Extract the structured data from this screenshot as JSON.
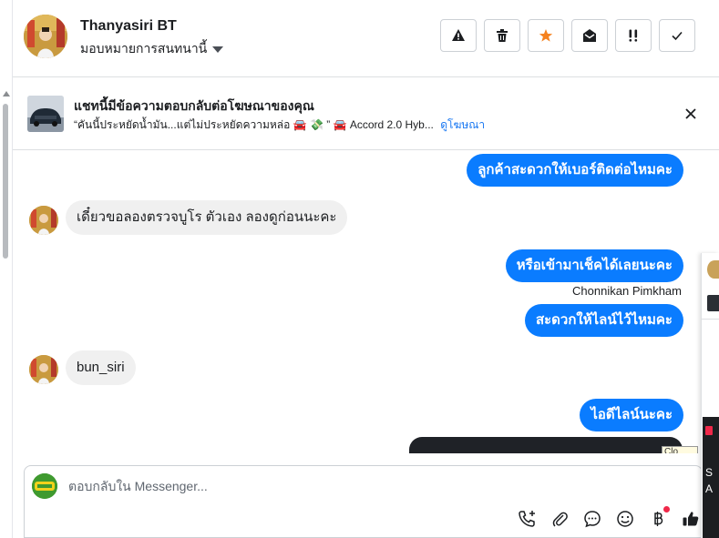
{
  "header": {
    "contact_name": "Thanyasiri BT",
    "assign_label": "มอบหมายการสนทนานี้",
    "toolbar": [
      {
        "icon": "warning-icon",
        "label": "!"
      },
      {
        "icon": "trash-icon",
        "label": ""
      },
      {
        "icon": "star-icon",
        "label": ""
      },
      {
        "icon": "open-envelope-icon",
        "label": ""
      },
      {
        "icon": "double-exclamation-icon",
        "label": ""
      },
      {
        "icon": "checkmark-icon",
        "label": ""
      }
    ]
  },
  "ad_bar": {
    "title": "แชทนี้มีข้อความตอบกลับต่อโฆษณาของคุณ",
    "snippet": "“คันนี้ประหยัดน้ำมัน...แต่ไม่ประหยัดความหล่อ 🚘 💸 ” 🚘 Accord 2.0 Hyb...",
    "link_label": "ดูโฆษณา"
  },
  "messages": [
    {
      "direction": "out",
      "text": "ลูกค้าสะดวกให้เบอร์ติดต่อไหมคะ"
    },
    {
      "direction": "in",
      "text": "เดี๋ยวขอลองตรวจบูโร ตัวเอง ลองดูก่อนนะคะ"
    },
    {
      "direction": "out",
      "text": "หรือเข้ามาเช็คได้เลยนะคะ"
    },
    {
      "direction": "sender",
      "text": "Chonnikan Pimkham"
    },
    {
      "direction": "out",
      "text": "สะดวกให้ไลน์ไว้ไหมคะ"
    },
    {
      "direction": "in",
      "text": "bun_siri"
    },
    {
      "direction": "out",
      "text": "ไอดีไลน์นะคะ"
    }
  ],
  "attachment_label": "Clo",
  "composer": {
    "placeholder": "ตอบกลับใน Messenger...",
    "tools": [
      "phone-add-icon",
      "paperclip-icon",
      "chat-bubble-icon",
      "smiley-icon",
      "baht-icon",
      "thumbs-up-icon"
    ]
  },
  "right_panel": {
    "dark_text": "S A"
  },
  "colors": {
    "accent": "#0a7cff",
    "link": "#1877f2",
    "star": "#f5821f",
    "notification": "#f02849"
  }
}
